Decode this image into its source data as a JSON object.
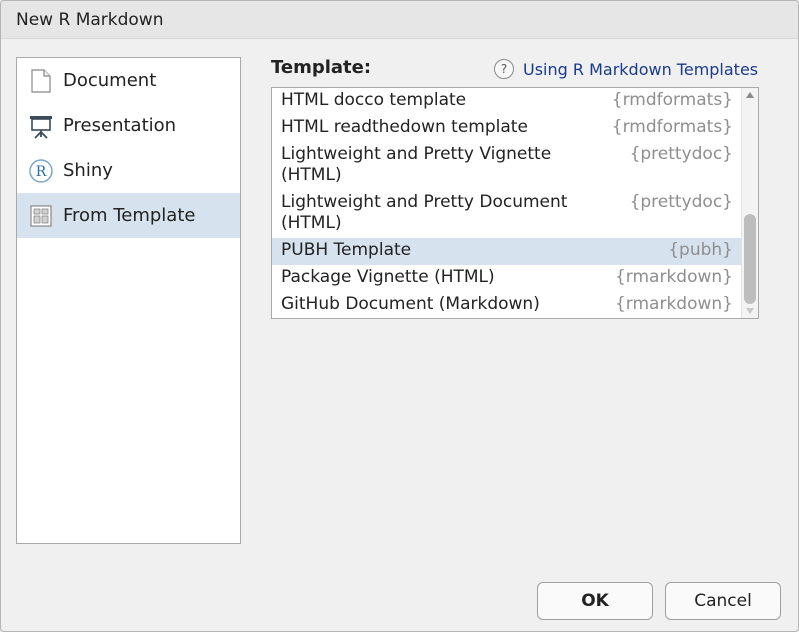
{
  "window": {
    "title": "New R Markdown"
  },
  "sidebar": {
    "items": [
      {
        "label": "Document",
        "icon": "document-icon",
        "selected": false
      },
      {
        "label": "Presentation",
        "icon": "presentation-icon",
        "selected": false
      },
      {
        "label": "Shiny",
        "icon": "shiny-r-icon",
        "selected": false
      },
      {
        "label": "From Template",
        "icon": "template-icon",
        "selected": true
      }
    ]
  },
  "template": {
    "label": "Template:",
    "help_icon": "?",
    "help_link": "Using R Markdown Templates",
    "items": [
      {
        "name": "HTML docco template",
        "package": "{rmdformats}",
        "selected": false
      },
      {
        "name": "HTML readthedown template",
        "package": "{rmdformats}",
        "selected": false
      },
      {
        "name": "Lightweight and Pretty Vignette\n(HTML)",
        "package": "{prettydoc}",
        "selected": false
      },
      {
        "name": "Lightweight and Pretty Document\n(HTML)",
        "package": "{prettydoc}",
        "selected": false
      },
      {
        "name": "PUBH Template",
        "package": "{pubh}",
        "selected": true
      },
      {
        "name": "Package Vignette (HTML)",
        "package": "{rmarkdown}",
        "selected": false
      },
      {
        "name": "GitHub Document (Markdown)",
        "package": "{rmarkdown}",
        "selected": false
      }
    ]
  },
  "buttons": {
    "ok": "OK",
    "cancel": "Cancel"
  },
  "colors": {
    "selection": "#d6e3ef",
    "link": "#1a3a8c",
    "package_text": "#8e8e8e"
  }
}
